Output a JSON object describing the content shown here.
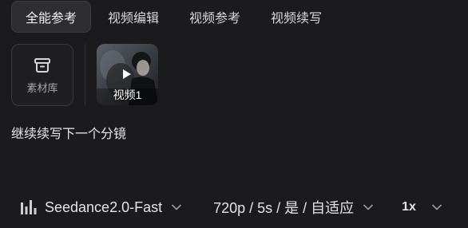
{
  "tabs": [
    {
      "label": "全能参考",
      "active": true
    },
    {
      "label": "视频编辑",
      "active": false
    },
    {
      "label": "视频参考",
      "active": false
    },
    {
      "label": "视频续写",
      "active": false
    }
  ],
  "assets": {
    "library_label": "素材库",
    "library_icon": "archive-box-icon",
    "video_label": "视频1",
    "video_icon": "play-icon"
  },
  "prompt": {
    "text": "继续续写下一个分镜"
  },
  "toolbar": {
    "model_icon": "audio-bars-icon",
    "model_name": "Seedance2.0-Fast",
    "settings": "720p / 5s / 是 / 自适应",
    "speed": "1x",
    "chevron_icon": "chevron-down-icon"
  },
  "colors": {
    "background": "#1b1b1d",
    "active_tab": "#2e2e31",
    "text": "#e6e6e8",
    "muted": "#a8a8ac"
  }
}
